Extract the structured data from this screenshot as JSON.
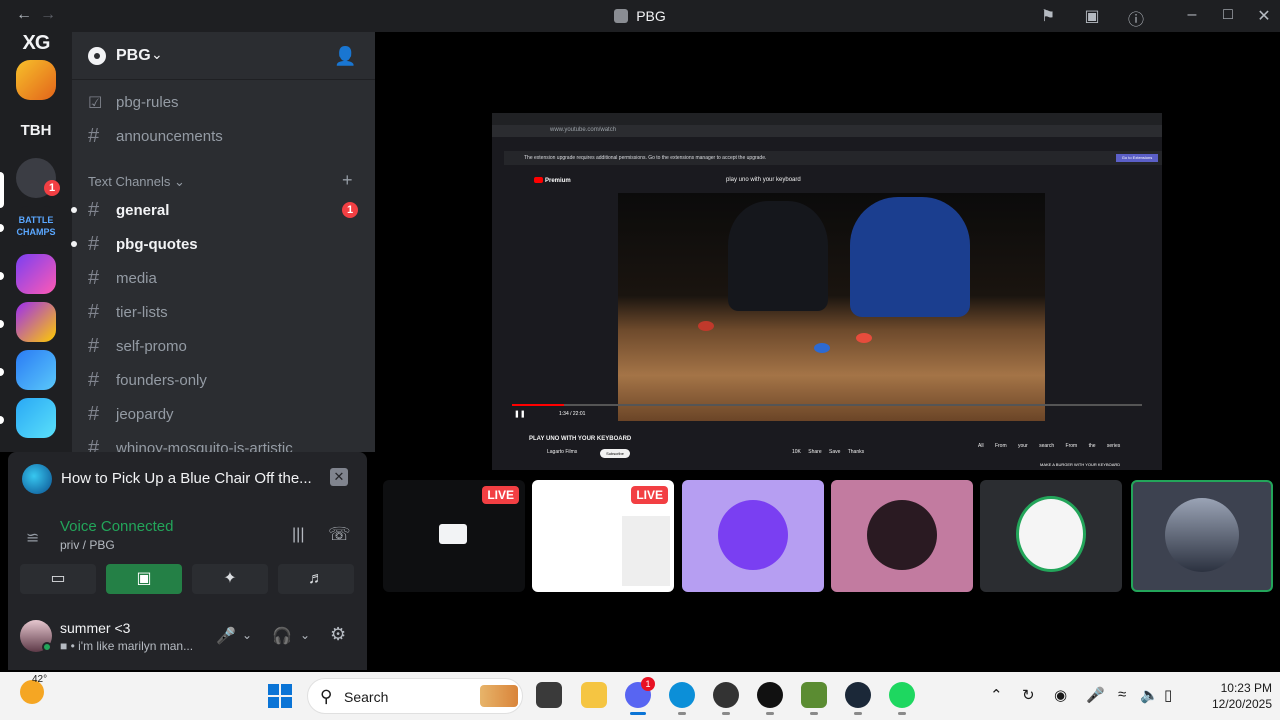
{
  "window": {
    "title": "PBG",
    "back_icon": "arrow-left-icon",
    "forward_icon": "arrow-right-icon"
  },
  "guilds": [
    {
      "label": "XG"
    },
    {
      "label": "TBH"
    },
    {
      "badge": "1"
    }
  ],
  "server": {
    "name": "PBG"
  },
  "channels_top": [
    {
      "name": "pbg-rules",
      "icon": "rules-icon"
    },
    {
      "name": "announcements",
      "icon": "hash-icon"
    }
  ],
  "category": {
    "label": "Text Channels"
  },
  "channels": [
    {
      "name": "general",
      "unread": true,
      "badge": "1"
    },
    {
      "name": "pbg-quotes",
      "unread": true
    },
    {
      "name": "media"
    },
    {
      "name": "tier-lists"
    },
    {
      "name": "self-promo"
    },
    {
      "name": "founders-only"
    },
    {
      "name": "jeopardy"
    },
    {
      "name": "whinoy-mosquito-is-artistic"
    }
  ],
  "popout": {
    "title": "How to Pick Up a Blue Chair Off the..."
  },
  "voice": {
    "status": "Voice Connected",
    "location": "priv / PBG"
  },
  "user": {
    "name": "summer <3",
    "status": "i'm like marilyn man..."
  },
  "stream": {
    "url": "www.youtube.com/watch",
    "ext_notice": "The extension upgrade requires additional permissions. Go to the extensions manager to accept the upgrade.",
    "ext_button": "Go to Extensions",
    "yt_logo": "Premium",
    "search_query": "play uno with your keyboard",
    "time": "1:34 / 22:01",
    "video_title": "PLAY UNO WITH YOUR KEYBOARD",
    "channel": "Lagarto Films",
    "subscribe": "Subscribe",
    "actions": "10K Share Save Thanks",
    "filters": "All From your search From the series",
    "side_title": "MAKE A BURGER WITH YOUR KEYBOARD"
  },
  "tiles": [
    {
      "live": "LIVE"
    },
    {
      "live": "LIVE"
    },
    {},
    {},
    {},
    {
      "selected": true
    }
  ],
  "taskbar": {
    "weather_temp": "42°",
    "search_label": "Search",
    "discord_badge": "1",
    "time": "10:23 PM",
    "date": "12/20/2025"
  },
  "colors": {
    "accent_green": "#23a55a",
    "danger_red": "#f23f43",
    "sidebar_bg": "#2b2d31",
    "guild_bg": "#1e1f22"
  }
}
